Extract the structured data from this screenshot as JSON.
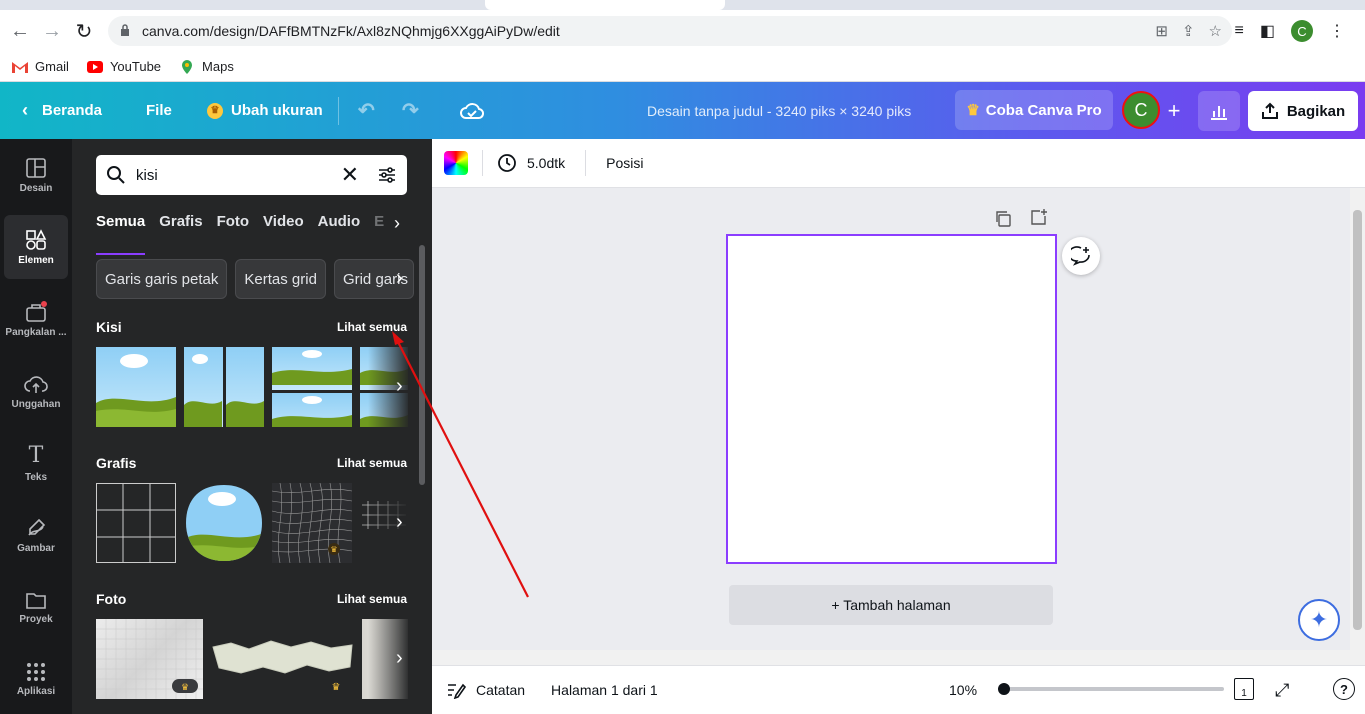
{
  "browser": {
    "url": "canva.com/design/DAFfBMTNzFk/Axl8zNQhmjg6XXggAiPyDw/edit",
    "profile_initial": "C",
    "bookmarks": [
      {
        "label": "Gmail",
        "icon": "gmail-icon"
      },
      {
        "label": "YouTube",
        "icon": "youtube-icon"
      },
      {
        "label": "Maps",
        "icon": "maps-icon"
      }
    ]
  },
  "topbar": {
    "home": "Beranda",
    "file": "File",
    "resize": "Ubah ukuran",
    "design_title": "Desain tanpa judul - 3240 piks × 3240 piks",
    "try_pro": "Coba Canva Pro",
    "avatar_initial": "C",
    "share": "Bagikan"
  },
  "rail": [
    {
      "label": "Desain",
      "icon": "layout-icon"
    },
    {
      "label": "Elemen",
      "icon": "shapes-icon",
      "active": true
    },
    {
      "label": "Pangkalan ...",
      "icon": "brand-kit-icon"
    },
    {
      "label": "Unggahan",
      "icon": "upload-cloud-icon"
    },
    {
      "label": "Teks",
      "icon": "text-icon"
    },
    {
      "label": "Gambar",
      "icon": "draw-icon"
    },
    {
      "label": "Proyek",
      "icon": "folder-icon"
    },
    {
      "label": "Aplikasi",
      "icon": "apps-grid-icon"
    }
  ],
  "panel": {
    "search_value": "kisi",
    "tabs": [
      "Semua",
      "Grafis",
      "Foto",
      "Video",
      "Audio",
      "E"
    ],
    "chips": [
      "Garis garis petak",
      "Kertas grid",
      "Grid garis"
    ],
    "sections": {
      "kisi": {
        "title": "Kisi",
        "see_all": "Lihat semua"
      },
      "grafis": {
        "title": "Grafis",
        "see_all": "Lihat semua"
      },
      "foto": {
        "title": "Foto",
        "see_all": "Lihat semua"
      }
    }
  },
  "editor_toolbar": {
    "duration": "5.0dtk",
    "position": "Posisi"
  },
  "canvas": {
    "add_page": "+ Tambah halaman"
  },
  "footer": {
    "notes": "Catatan",
    "page_indicator": "Halaman 1 dari 1",
    "zoom": "10%",
    "page_count_badge": "1",
    "zoom_fraction": 0.1
  },
  "colors": {
    "accent": "#8b3dff",
    "annotation_arrow": "#e01010"
  }
}
